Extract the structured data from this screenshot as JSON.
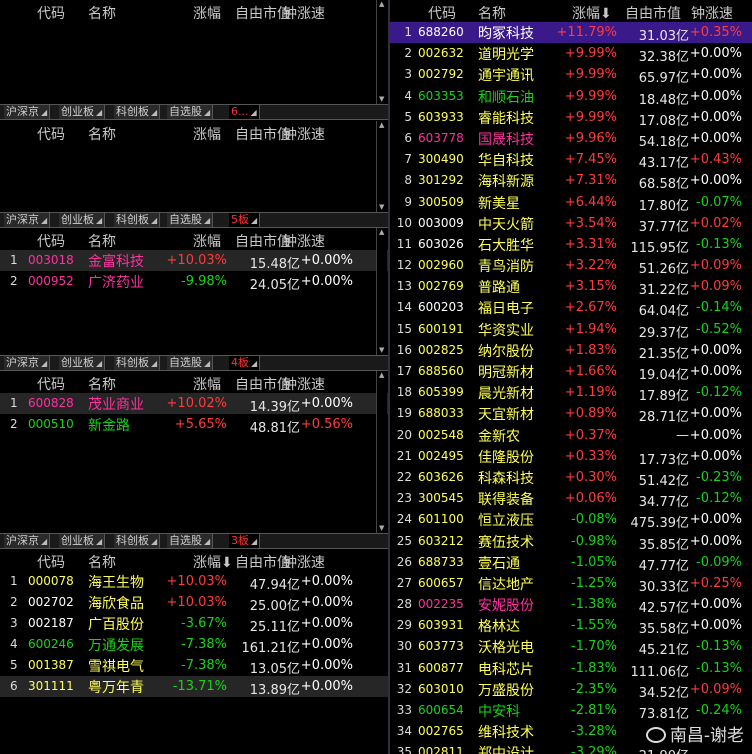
{
  "headers": {
    "code": "代码",
    "name": "名称",
    "chg": "涨幅",
    "chg_sorted": "涨幅⬇",
    "cap": "自由市值",
    "spd": "钟涨速"
  },
  "tabs": [
    {
      "items": [
        "沪深京",
        "创业板",
        "科创板",
        "自选股"
      ],
      "active": "6..."
    },
    {
      "items": [
        "沪深京",
        "创业板",
        "科创板",
        "自选股"
      ],
      "active": "5板"
    },
    {
      "items": [
        "沪深京",
        "创业板",
        "科创板",
        "自选股"
      ],
      "active": "4板"
    },
    {
      "items": [
        "沪深京",
        "创业板",
        "科创板",
        "自选股"
      ],
      "active": "3板"
    }
  ],
  "panels": [
    {
      "rows": []
    },
    {
      "rows": []
    },
    {
      "rows": [
        {
          "idx": "1",
          "code": "003018",
          "name": "金富科技",
          "chg": "+10.03%",
          "cap": "15.48亿",
          "spd": "+0.00%",
          "code_c": "pk",
          "name_c": "pk",
          "chg_c": "up",
          "spd_c": "fl",
          "sel": true
        },
        {
          "idx": "2",
          "code": "000952",
          "name": "广济药业",
          "chg": "-9.98%",
          "cap": "24.05亿",
          "spd": "+0.00%",
          "code_c": "pk",
          "name_c": "pk",
          "chg_c": "dn",
          "spd_c": "fl"
        }
      ]
    },
    {
      "rows": [
        {
          "idx": "1",
          "code": "600828",
          "name": "茂业商业",
          "chg": "+10.02%",
          "cap": "14.39亿",
          "spd": "+0.00%",
          "code_c": "pk",
          "name_c": "pk",
          "chg_c": "up",
          "spd_c": "fl",
          "sel": true
        },
        {
          "idx": "2",
          "code": "000510",
          "name": "新金路",
          "chg": "+5.65%",
          "cap": "48.81亿",
          "spd": "+0.56%",
          "code_c": "gr",
          "name_c": "gr",
          "chg_c": "up",
          "spd_c": "up"
        }
      ]
    },
    {
      "rows": [
        {
          "idx": "1",
          "code": "000078",
          "name": "海王生物",
          "chg": "+10.03%",
          "cap": "47.94亿",
          "spd": "+0.00%",
          "code_c": "yl",
          "name_c": "yl",
          "chg_c": "up",
          "spd_c": "fl"
        },
        {
          "idx": "2",
          "code": "002702",
          "name": "海欣食品",
          "chg": "+10.03%",
          "cap": "25.00亿",
          "spd": "+0.00%",
          "code_c": "wh",
          "name_c": "yl",
          "chg_c": "up",
          "spd_c": "fl"
        },
        {
          "idx": "3",
          "code": "002187",
          "name": "广百股份",
          "chg": "-3.67%",
          "cap": "25.11亿",
          "spd": "+0.00%",
          "code_c": "wh",
          "name_c": "yl",
          "chg_c": "dn",
          "spd_c": "fl"
        },
        {
          "idx": "4",
          "code": "600246",
          "name": "万通发展",
          "chg": "-7.38%",
          "cap": "161.21亿",
          "spd": "+0.00%",
          "code_c": "gr",
          "name_c": "gr",
          "chg_c": "dn",
          "spd_c": "fl"
        },
        {
          "idx": "5",
          "code": "001387",
          "name": "雪祺电气",
          "chg": "-7.38%",
          "cap": "13.05亿",
          "spd": "+0.00%",
          "code_c": "yl",
          "name_c": "yl",
          "chg_c": "dn",
          "spd_c": "fl"
        },
        {
          "idx": "6",
          "code": "301111",
          "name": "粤万年青",
          "chg": "-13.71%",
          "cap": "13.89亿",
          "spd": "+0.00%",
          "code_c": "yl",
          "name_c": "yl",
          "chg_c": "dn",
          "spd_c": "fl",
          "sel": true
        }
      ]
    }
  ],
  "right_rows": [
    {
      "idx": "1",
      "code": "688260",
      "name": "昀冢科技",
      "chg": "+11.79%",
      "cap": "31.03亿",
      "spd": "+0.35%",
      "code_c": "wh",
      "name_c": "wh",
      "chg_c": "up",
      "spd_c": "up",
      "sel": true
    },
    {
      "idx": "2",
      "code": "002632",
      "name": "道明光学",
      "chg": "+9.99%",
      "cap": "32.38亿",
      "spd": "+0.00%",
      "code_c": "yl",
      "name_c": "yl",
      "chg_c": "up",
      "spd_c": "fl"
    },
    {
      "idx": "3",
      "code": "002792",
      "name": "通宇通讯",
      "chg": "+9.99%",
      "cap": "65.97亿",
      "spd": "+0.00%",
      "code_c": "yl",
      "name_c": "yl",
      "chg_c": "up",
      "spd_c": "fl"
    },
    {
      "idx": "4",
      "code": "603353",
      "name": "和顺石油",
      "chg": "+9.99%",
      "cap": "18.48亿",
      "spd": "+0.00%",
      "code_c": "gr",
      "name_c": "gr",
      "chg_c": "up",
      "spd_c": "fl"
    },
    {
      "idx": "5",
      "code": "603933",
      "name": "睿能科技",
      "chg": "+9.99%",
      "cap": "17.08亿",
      "spd": "+0.00%",
      "code_c": "yl",
      "name_c": "yl",
      "chg_c": "up",
      "spd_c": "fl"
    },
    {
      "idx": "6",
      "code": "603778",
      "name": "国晟科技",
      "chg": "+9.96%",
      "cap": "54.18亿",
      "spd": "+0.00%",
      "code_c": "pk",
      "name_c": "pk",
      "chg_c": "up",
      "spd_c": "fl"
    },
    {
      "idx": "7",
      "code": "300490",
      "name": "华自科技",
      "chg": "+7.45%",
      "cap": "43.17亿",
      "spd": "+0.43%",
      "code_c": "yl",
      "name_c": "yl",
      "chg_c": "up",
      "spd_c": "up"
    },
    {
      "idx": "8",
      "code": "301292",
      "name": "海科新源",
      "chg": "+7.31%",
      "cap": "68.58亿",
      "spd": "+0.00%",
      "code_c": "yl",
      "name_c": "yl",
      "chg_c": "up",
      "spd_c": "fl"
    },
    {
      "idx": "9",
      "code": "300509",
      "name": "新美星",
      "chg": "+6.44%",
      "cap": "17.80亿",
      "spd": "-0.07%",
      "code_c": "yl",
      "name_c": "yl",
      "chg_c": "up",
      "spd_c": "dn"
    },
    {
      "idx": "10",
      "code": "003009",
      "name": "中天火箭",
      "chg": "+3.54%",
      "cap": "37.77亿",
      "spd": "+0.02%",
      "code_c": "wh",
      "name_c": "yl",
      "chg_c": "up",
      "spd_c": "up"
    },
    {
      "idx": "11",
      "code": "603026",
      "name": "石大胜华",
      "chg": "+3.31%",
      "cap": "115.95亿",
      "spd": "-0.13%",
      "code_c": "wh",
      "name_c": "yl",
      "chg_c": "up",
      "spd_c": "dn"
    },
    {
      "idx": "12",
      "code": "002960",
      "name": "青鸟消防",
      "chg": "+3.22%",
      "cap": "51.26亿",
      "spd": "+0.09%",
      "code_c": "yl",
      "name_c": "yl",
      "chg_c": "up",
      "spd_c": "up"
    },
    {
      "idx": "13",
      "code": "002769",
      "name": "普路通",
      "chg": "+3.15%",
      "cap": "31.22亿",
      "spd": "+0.09%",
      "code_c": "yl",
      "name_c": "yl",
      "chg_c": "up",
      "spd_c": "up"
    },
    {
      "idx": "14",
      "code": "600203",
      "name": "福日电子",
      "chg": "+2.67%",
      "cap": "64.04亿",
      "spd": "-0.14%",
      "code_c": "wh",
      "name_c": "yl",
      "chg_c": "up",
      "spd_c": "dn"
    },
    {
      "idx": "15",
      "code": "600191",
      "name": "华资实业",
      "chg": "+1.94%",
      "cap": "29.37亿",
      "spd": "-0.52%",
      "code_c": "yl",
      "name_c": "yl",
      "chg_c": "up",
      "spd_c": "dn"
    },
    {
      "idx": "16",
      "code": "002825",
      "name": "纳尔股份",
      "chg": "+1.83%",
      "cap": "21.35亿",
      "spd": "+0.00%",
      "code_c": "yl",
      "name_c": "yl",
      "chg_c": "up",
      "spd_c": "fl"
    },
    {
      "idx": "17",
      "code": "688560",
      "name": "明冠新材",
      "chg": "+1.66%",
      "cap": "19.04亿",
      "spd": "+0.00%",
      "code_c": "yl",
      "name_c": "yl",
      "chg_c": "up",
      "spd_c": "fl"
    },
    {
      "idx": "18",
      "code": "605399",
      "name": "晨光新材",
      "chg": "+1.19%",
      "cap": "17.89亿",
      "spd": "-0.12%",
      "code_c": "yl",
      "name_c": "yl",
      "chg_c": "up",
      "spd_c": "dn"
    },
    {
      "idx": "19",
      "code": "688033",
      "name": "天宜新材",
      "chg": "+0.89%",
      "cap": "28.71亿",
      "spd": "+0.00%",
      "code_c": "yl",
      "name_c": "yl",
      "chg_c": "up",
      "spd_c": "fl"
    },
    {
      "idx": "20",
      "code": "002548",
      "name": "金新农",
      "chg": "+0.37%",
      "cap": "—",
      "spd": "+0.00%",
      "code_c": "yl",
      "name_c": "yl",
      "chg_c": "up",
      "spd_c": "fl"
    },
    {
      "idx": "21",
      "code": "002495",
      "name": "佳隆股份",
      "chg": "+0.33%",
      "cap": "17.73亿",
      "spd": "+0.00%",
      "code_c": "yl",
      "name_c": "yl",
      "chg_c": "up",
      "spd_c": "fl"
    },
    {
      "idx": "22",
      "code": "603626",
      "name": "科森科技",
      "chg": "+0.30%",
      "cap": "51.42亿",
      "spd": "-0.23%",
      "code_c": "yl",
      "name_c": "yl",
      "chg_c": "up",
      "spd_c": "dn"
    },
    {
      "idx": "23",
      "code": "300545",
      "name": "联得装备",
      "chg": "+0.06%",
      "cap": "34.77亿",
      "spd": "-0.12%",
      "code_c": "yl",
      "name_c": "yl",
      "chg_c": "up",
      "spd_c": "dn"
    },
    {
      "idx": "24",
      "code": "601100",
      "name": "恒立液压",
      "chg": "-0.08%",
      "cap": "475.39亿",
      "spd": "+0.00%",
      "code_c": "yl",
      "name_c": "yl",
      "chg_c": "dn",
      "spd_c": "fl"
    },
    {
      "idx": "25",
      "code": "603212",
      "name": "赛伍技术",
      "chg": "-0.98%",
      "cap": "35.85亿",
      "spd": "+0.00%",
      "code_c": "yl",
      "name_c": "yl",
      "chg_c": "dn",
      "spd_c": "fl"
    },
    {
      "idx": "26",
      "code": "688733",
      "name": "壹石通",
      "chg": "-1.05%",
      "cap": "47.77亿",
      "spd": "-0.09%",
      "code_c": "yl",
      "name_c": "yl",
      "chg_c": "dn",
      "spd_c": "dn"
    },
    {
      "idx": "27",
      "code": "600657",
      "name": "信达地产",
      "chg": "-1.25%",
      "cap": "30.33亿",
      "spd": "+0.25%",
      "code_c": "yl",
      "name_c": "yl",
      "chg_c": "dn",
      "spd_c": "up"
    },
    {
      "idx": "28",
      "code": "002235",
      "name": "安妮股份",
      "chg": "-1.38%",
      "cap": "42.57亿",
      "spd": "+0.00%",
      "code_c": "pk",
      "name_c": "pk",
      "chg_c": "dn",
      "spd_c": "fl"
    },
    {
      "idx": "29",
      "code": "603931",
      "name": "格林达",
      "chg": "-1.55%",
      "cap": "35.58亿",
      "spd": "+0.00%",
      "code_c": "yl",
      "name_c": "yl",
      "chg_c": "dn",
      "spd_c": "fl"
    },
    {
      "idx": "30",
      "code": "603773",
      "name": "沃格光电",
      "chg": "-1.70%",
      "cap": "45.21亿",
      "spd": "-0.13%",
      "code_c": "yl",
      "name_c": "yl",
      "chg_c": "dn",
      "spd_c": "dn"
    },
    {
      "idx": "31",
      "code": "600877",
      "name": "电科芯片",
      "chg": "-1.83%",
      "cap": "111.06亿",
      "spd": "-0.13%",
      "code_c": "yl",
      "name_c": "yl",
      "chg_c": "dn",
      "spd_c": "dn"
    },
    {
      "idx": "32",
      "code": "603010",
      "name": "万盛股份",
      "chg": "-2.35%",
      "cap": "34.52亿",
      "spd": "+0.09%",
      "code_c": "yl",
      "name_c": "yl",
      "chg_c": "dn",
      "spd_c": "up"
    },
    {
      "idx": "33",
      "code": "600654",
      "name": "中安科",
      "chg": "-2.81%",
      "cap": "73.81亿",
      "spd": "-0.24%",
      "code_c": "gr",
      "name_c": "gr",
      "chg_c": "dn",
      "spd_c": "dn"
    },
    {
      "idx": "34",
      "code": "002765",
      "name": "维科技术",
      "chg": "-3.28%",
      "cap": "",
      "spd": "",
      "code_c": "yl",
      "name_c": "yl",
      "chg_c": "dn",
      "spd_c": "fl"
    },
    {
      "idx": "35",
      "code": "002811",
      "name": "郑中设计",
      "chg": "-3.29%",
      "cap": "21.90亿",
      "spd": "",
      "code_c": "yl",
      "name_c": "yl",
      "chg_c": "dn",
      "spd_c": "fl"
    }
  ],
  "colors": {
    "pk": "#ff30a0",
    "yl": "#ffff55",
    "gr": "#19d219",
    "wh": "#ffffff",
    "up": "#ff3b3b",
    "dn": "#19d219",
    "fl": "#ffffff"
  },
  "watermark": "南昌-谢老"
}
